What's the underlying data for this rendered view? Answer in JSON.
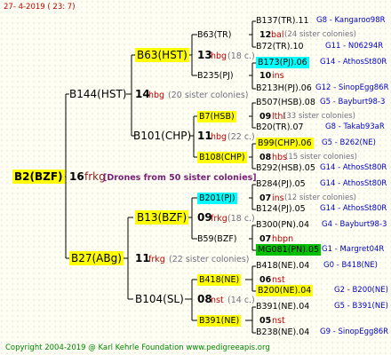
{
  "header": {
    "date": "27-  4-2019 ( 23:  7)"
  },
  "root": {
    "id": "B2(BZF)",
    "gen": "16",
    "colony": "frkg",
    "note": "[Drones from 50 sister colonies]"
  },
  "sire": {
    "id": "B144(HST)",
    "gen": "14",
    "colony": "hbg",
    "sisters": "(20 sister colonies)",
    "sire": {
      "id": "B63(HST)",
      "gen": "13",
      "colony": "hbg",
      "sisters": "(18 c.)",
      "sire": {
        "id": "B63(TR)",
        "gen": "12",
        "colony": "bal",
        "sisters": "(24 sister colonies)",
        "sire": {
          "id": "B137(TR).11",
          "extra": "G8 - Kangaroo98R"
        },
        "dam": {
          "id": "B72(TR).10",
          "extra": "G11 - N06294R"
        }
      },
      "dam": {
        "id": "B235(PJ)",
        "gen": "10",
        "colony": "ins",
        "sire": {
          "id": "B173(PJ).06",
          "extra": "G14 - AthosSt80R"
        },
        "dam": {
          "id": "B213H(PJ).06",
          "extra": "G12 - SinopEgg86R"
        }
      }
    },
    "dam": {
      "id": "B101(CHP)",
      "gen": "11",
      "colony": "hbg",
      "sisters": "(22 c.)",
      "sire": {
        "id": "B7(HSB)",
        "gen": "09",
        "colony": "lthl",
        "sisters": "(33 sister colonies)",
        "sire": {
          "id": "B507(HSB).08",
          "extra": "G5 - Bayburt98-3"
        },
        "dam": {
          "id": "B20(TR).07",
          "extra": "G8 - Takab93aR"
        }
      },
      "dam": {
        "id": "B108(CHP)",
        "gen": "08",
        "colony": "hbs",
        "sisters": "(15 sister colonies)",
        "sire": {
          "id": "B99(CHP).06",
          "extra": "G5 - B262(NE)"
        },
        "dam": {
          "id": "B292(HSB).05",
          "extra": "G14 - AthosSt80R"
        }
      }
    }
  },
  "dam": {
    "id": "B27(ABg)",
    "gen": "11",
    "colony": "frkg",
    "sisters": "(22 sister colonies)",
    "sire": {
      "id": "B13(BZF)",
      "gen": "09",
      "colony": "frkg",
      "sisters": "(18 c.)",
      "sire": {
        "id": "B201(PJ)",
        "gen": "07",
        "colony": "ins",
        "sisters": "(12 sister colonies)",
        "sire": {
          "id": "B284(PJ).05",
          "extra": "G14 - AthosSt80R"
        },
        "dam": {
          "id": "B124(PJ).05",
          "extra": "G14 - AthosSt80R"
        }
      },
      "dam": {
        "id": "B59(BZF)",
        "gen": "07",
        "colony": "hbpn",
        "sire": {
          "id": "B300(PN).04",
          "extra": "G4 - Bayburt98-3"
        },
        "dam": {
          "id": "MG081(PN).05",
          "extra": "G1 - Margret04R"
        }
      }
    },
    "dam": {
      "id": "B104(SL)",
      "gen": "08",
      "colony": "nst",
      "sisters": "(14 c.)",
      "sire": {
        "id": "B418(NE)",
        "gen": "06",
        "colony": "nst",
        "sire": {
          "id": "B418(NE).04",
          "extra": "G0 - B418(NE)"
        },
        "dam": {
          "id": "B200(NE).04",
          "extra": "G2 - B200(NE)"
        }
      },
      "dam": {
        "id": "B391(NE)",
        "gen": "05",
        "colony": "nst",
        "sire": {
          "id": "B391(NE).04",
          "extra": "G5 - B391(NE)"
        },
        "dam": {
          "id": "B238(NE).04",
          "extra": "G9 - SinopEgg86R"
        }
      }
    }
  },
  "colors": {
    "yellow": "#ffff00",
    "cyan": "#00ffff",
    "green": "#00c000",
    "gen_red": "#c00000",
    "blue": "#0000c8",
    "copyright": "#008800"
  },
  "footer": {
    "copyright": "Copyright 2004-2019 @ Karl Kehrle Foundation    www.pedigreeapis.org"
  }
}
